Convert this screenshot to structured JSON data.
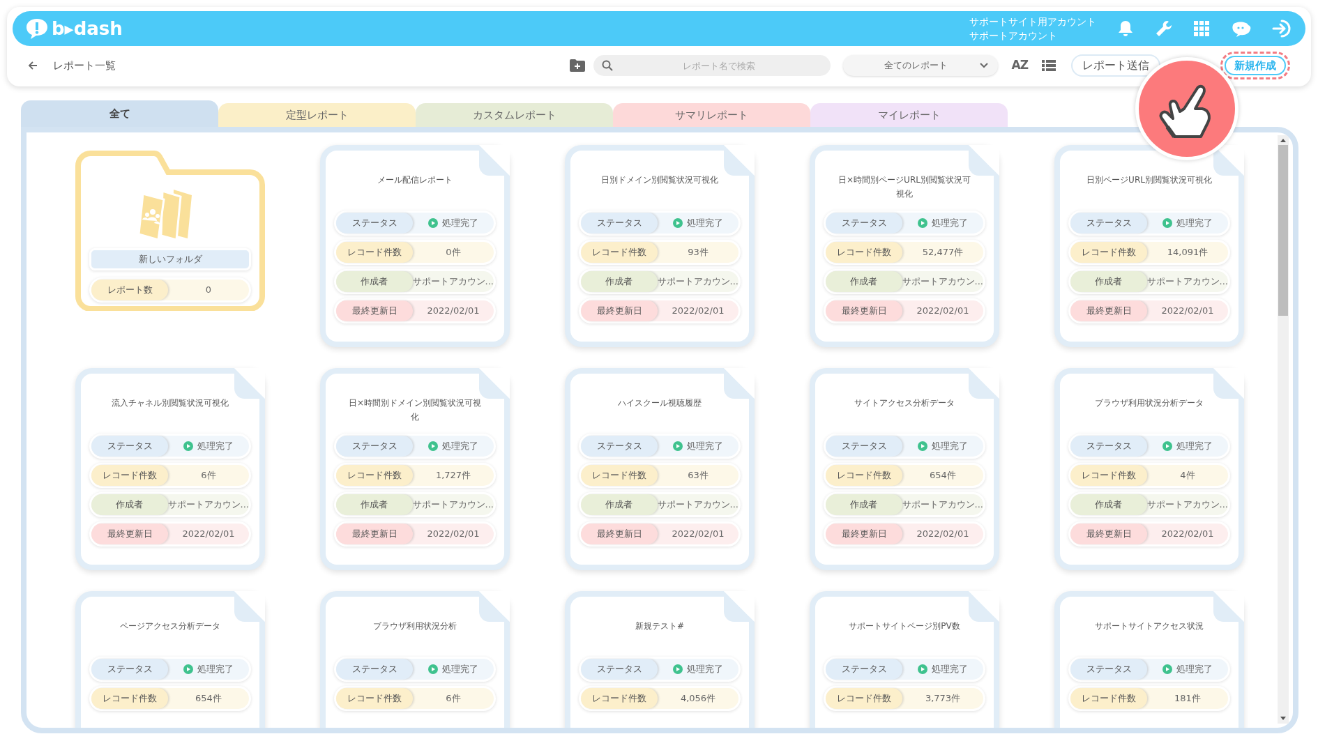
{
  "header": {
    "logo": "b▸dash",
    "account_site": "サポートサイト用アカウント",
    "account_name": "サポートアカウント"
  },
  "toolbar": {
    "title": "レポート一覧",
    "search": {
      "placeholder": "レポート名で検索"
    },
    "filter": "全てのレポート",
    "sort_label": "AZ",
    "send_button": "レポート送信",
    "new_button": "新規作成"
  },
  "tabs": [
    {
      "label": "全て",
      "selected": true,
      "color": "#cfe0f0"
    },
    {
      "label": "定型レポート",
      "selected": false,
      "color": "#fbefc8"
    },
    {
      "label": "カスタムレポート",
      "selected": false,
      "color": "#e6ecd6"
    },
    {
      "label": "サマリレポート",
      "selected": false,
      "color": "#fdd9d9"
    },
    {
      "label": "マイレポート",
      "selected": false,
      "color": "#f1e2f8"
    }
  ],
  "items": [
    {
      "kind": "folder",
      "name": "新しいフォルダ",
      "count_label": "レポート数",
      "count": "0"
    },
    {
      "kind": "report",
      "title": "メール配信レポート",
      "rows": [
        {
          "kind": "status",
          "label": "ステータス",
          "value": "処理完了"
        },
        {
          "kind": "records",
          "label": "レコード件数",
          "value": "0件"
        },
        {
          "kind": "author",
          "label": "作成者",
          "value": "サポートアカウン..."
        },
        {
          "kind": "updated",
          "label": "最終更新日",
          "value": "2022/02/01"
        }
      ]
    },
    {
      "kind": "report",
      "title": "日別ドメイン別閲覧状況可視化",
      "rows": [
        {
          "kind": "status",
          "label": "ステータス",
          "value": "処理完了"
        },
        {
          "kind": "records",
          "label": "レコード件数",
          "value": "93件"
        },
        {
          "kind": "author",
          "label": "作成者",
          "value": "サポートアカウン..."
        },
        {
          "kind": "updated",
          "label": "最終更新日",
          "value": "2022/02/01"
        }
      ]
    },
    {
      "kind": "report",
      "title": "日×時間別ページURL別閲覧状況可視化",
      "rows": [
        {
          "kind": "status",
          "label": "ステータス",
          "value": "処理完了"
        },
        {
          "kind": "records",
          "label": "レコード件数",
          "value": "52,477件"
        },
        {
          "kind": "author",
          "label": "作成者",
          "value": "サポートアカウン..."
        },
        {
          "kind": "updated",
          "label": "最終更新日",
          "value": "2022/02/01"
        }
      ]
    },
    {
      "kind": "report",
      "title": "日別ページURL別閲覧状況可視化",
      "rows": [
        {
          "kind": "status",
          "label": "ステータス",
          "value": "処理完了"
        },
        {
          "kind": "records",
          "label": "レコード件数",
          "value": "14,091件"
        },
        {
          "kind": "author",
          "label": "作成者",
          "value": "サポートアカウン..."
        },
        {
          "kind": "updated",
          "label": "最終更新日",
          "value": "2022/02/01"
        }
      ]
    },
    {
      "kind": "report",
      "title": "流入チャネル別閲覧状況可視化",
      "rows": [
        {
          "kind": "status",
          "label": "ステータス",
          "value": "処理完了"
        },
        {
          "kind": "records",
          "label": "レコード件数",
          "value": "6件"
        },
        {
          "kind": "author",
          "label": "作成者",
          "value": "サポートアカウン..."
        },
        {
          "kind": "updated",
          "label": "最終更新日",
          "value": "2022/02/01"
        }
      ]
    },
    {
      "kind": "report",
      "title": "日×時間別ドメイン別閲覧状況可視化",
      "rows": [
        {
          "kind": "status",
          "label": "ステータス",
          "value": "処理完了"
        },
        {
          "kind": "records",
          "label": "レコード件数",
          "value": "1,727件"
        },
        {
          "kind": "author",
          "label": "作成者",
          "value": "サポートアカウン..."
        },
        {
          "kind": "updated",
          "label": "最終更新日",
          "value": "2022/02/01"
        }
      ]
    },
    {
      "kind": "report",
      "title": "ハイスクール視聴履歴",
      "rows": [
        {
          "kind": "status",
          "label": "ステータス",
          "value": "処理完了"
        },
        {
          "kind": "records",
          "label": "レコード件数",
          "value": "63件"
        },
        {
          "kind": "author",
          "label": "作成者",
          "value": "サポートアカウン..."
        },
        {
          "kind": "updated",
          "label": "最終更新日",
          "value": "2022/02/01"
        }
      ]
    },
    {
      "kind": "report",
      "title": "サイトアクセス分析データ",
      "rows": [
        {
          "kind": "status",
          "label": "ステータス",
          "value": "処理完了"
        },
        {
          "kind": "records",
          "label": "レコード件数",
          "value": "654件"
        },
        {
          "kind": "author",
          "label": "作成者",
          "value": "サポートアカウン..."
        },
        {
          "kind": "updated",
          "label": "最終更新日",
          "value": "2022/02/01"
        }
      ]
    },
    {
      "kind": "report",
      "title": "ブラウザ利用状況分析データ",
      "rows": [
        {
          "kind": "status",
          "label": "ステータス",
          "value": "処理完了"
        },
        {
          "kind": "records",
          "label": "レコード件数",
          "value": "4件"
        },
        {
          "kind": "author",
          "label": "作成者",
          "value": "サポートアカウン..."
        },
        {
          "kind": "updated",
          "label": "最終更新日",
          "value": "2022/02/01"
        }
      ]
    },
    {
      "kind": "report",
      "title": "ページアクセス分析データ",
      "rows": [
        {
          "kind": "status",
          "label": "ステータス",
          "value": "処理完了"
        },
        {
          "kind": "records",
          "label": "レコード件数",
          "value": "654件"
        }
      ]
    },
    {
      "kind": "report",
      "title": "ブラウザ利用状況分析",
      "rows": [
        {
          "kind": "status",
          "label": "ステータス",
          "value": "処理完了"
        },
        {
          "kind": "records",
          "label": "レコード件数",
          "value": "6件"
        }
      ]
    },
    {
      "kind": "report",
      "title": "新規テスト#",
      "rows": [
        {
          "kind": "status",
          "label": "ステータス",
          "value": "処理完了"
        },
        {
          "kind": "records",
          "label": "レコード件数",
          "value": "4,056件"
        }
      ]
    },
    {
      "kind": "report",
      "title": "サポートサイトページ別PV数",
      "rows": [
        {
          "kind": "status",
          "label": "ステータス",
          "value": "処理完了"
        },
        {
          "kind": "records",
          "label": "レコード件数",
          "value": "3,773件"
        }
      ]
    },
    {
      "kind": "report",
      "title": "サポートサイトアクセス状況",
      "rows": [
        {
          "kind": "status",
          "label": "ステータス",
          "value": "処理完了"
        },
        {
          "kind": "records",
          "label": "レコード件数",
          "value": "181件"
        }
      ]
    }
  ]
}
